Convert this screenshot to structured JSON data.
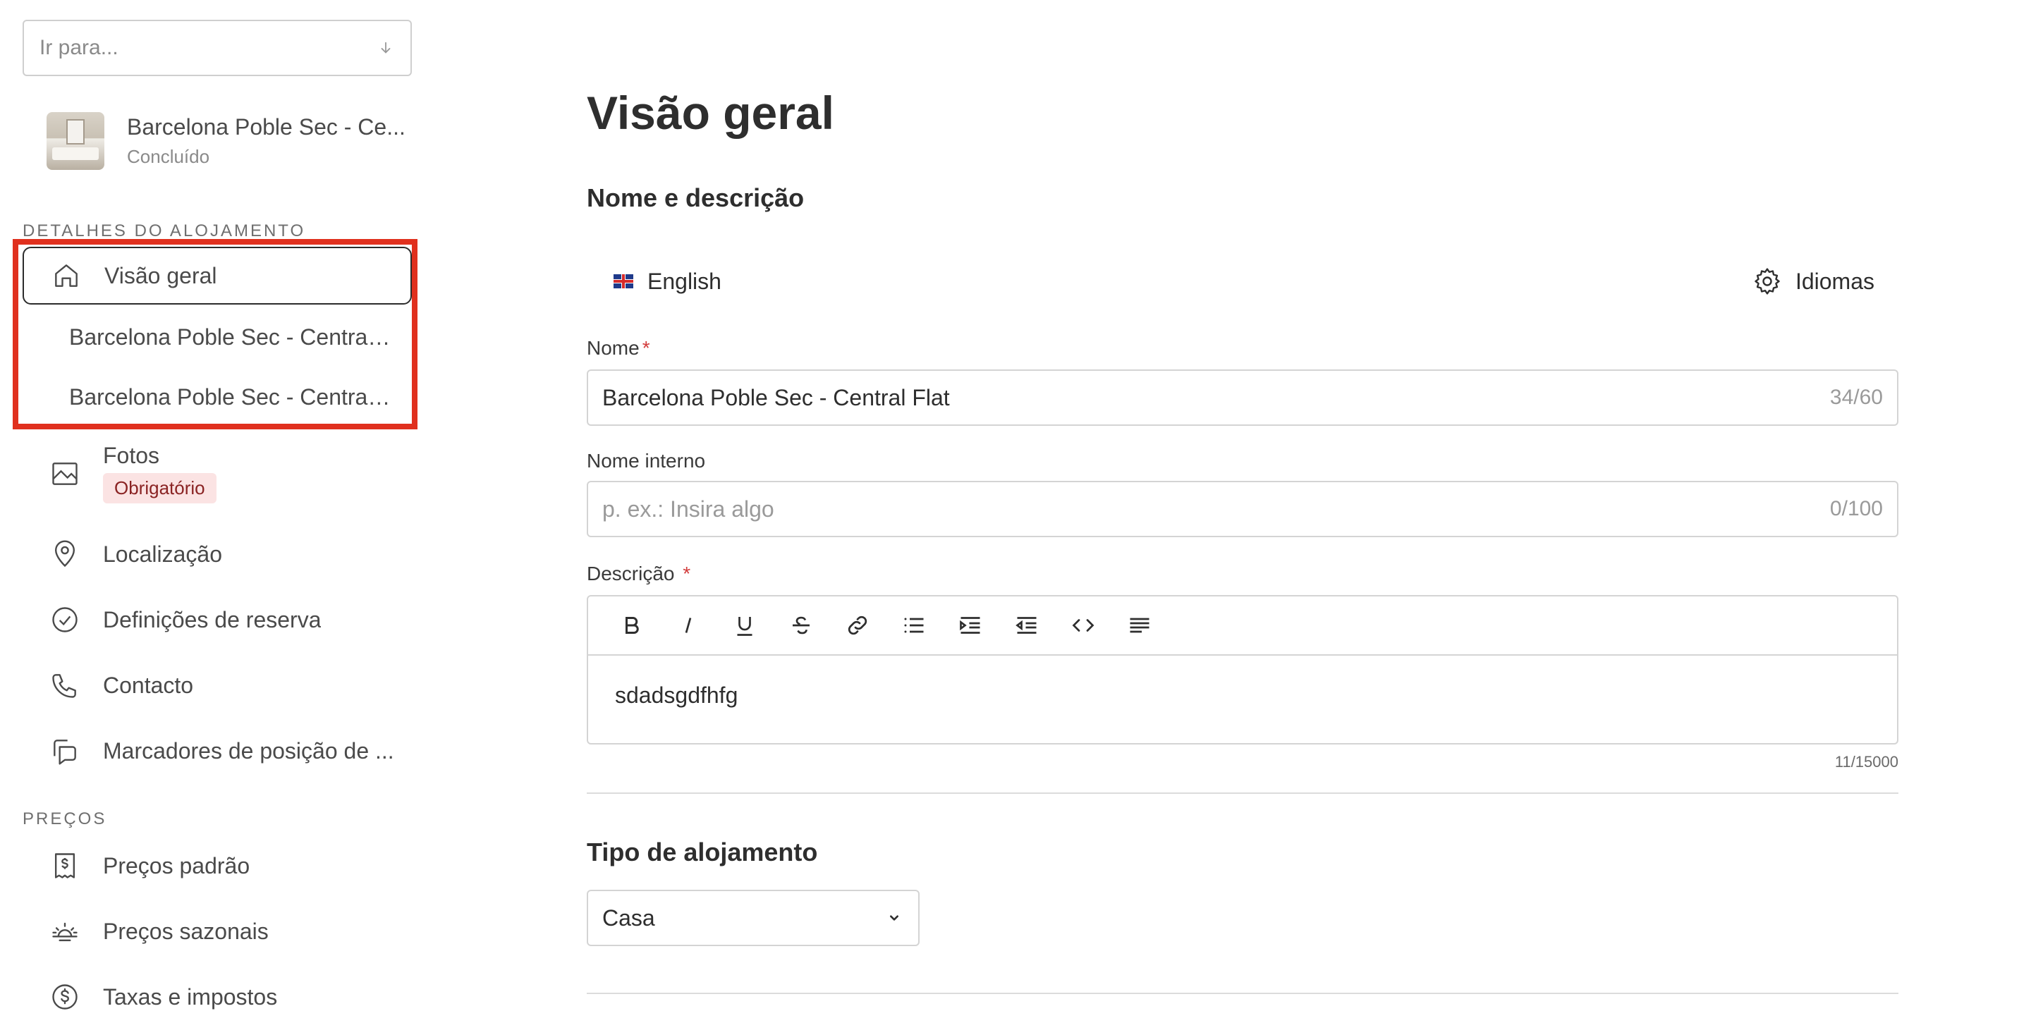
{
  "sidebar": {
    "goto_placeholder": "Ir para...",
    "listing": {
      "name": "Barcelona Poble Sec - Ce...",
      "status": "Concluído"
    },
    "section_details": "DETALHES DO ALOJAMENTO",
    "items": {
      "overview": "Visão geral",
      "sub1": "Barcelona Poble Sec - Central F...",
      "sub2": "Barcelona Poble Sec - Central F...",
      "photos": "Fotos",
      "photos_badge": "Obrigatório",
      "location": "Localização",
      "booking": "Definições de reserva",
      "contact": "Contacto",
      "markers": "Marcadores de posição de ..."
    },
    "section_prices": "PREÇOS",
    "price_items": {
      "standard": "Preços padrão",
      "seasonal": "Preços sazonais",
      "taxes": "Taxas e impostos"
    }
  },
  "main": {
    "title": "Visão geral",
    "section_name": "Nome e descrição",
    "language": "English",
    "languages_button": "Idiomas",
    "name_label": "Nome",
    "name_value": "Barcelona Poble Sec - Central Flat",
    "name_counter": "34/60",
    "internal_label": "Nome interno",
    "internal_placeholder": "p. ex.: Insira algo",
    "internal_counter": "0/100",
    "description_label": "Descrição",
    "description_value": "sdadsgdfhfg",
    "description_counter": "11/15000",
    "type_section": "Tipo de alojamento",
    "type_value": "Casa"
  },
  "colors": {
    "highlight": "#e0301e",
    "badge_bg": "#fbe3e3",
    "required": "#d23b3b"
  }
}
